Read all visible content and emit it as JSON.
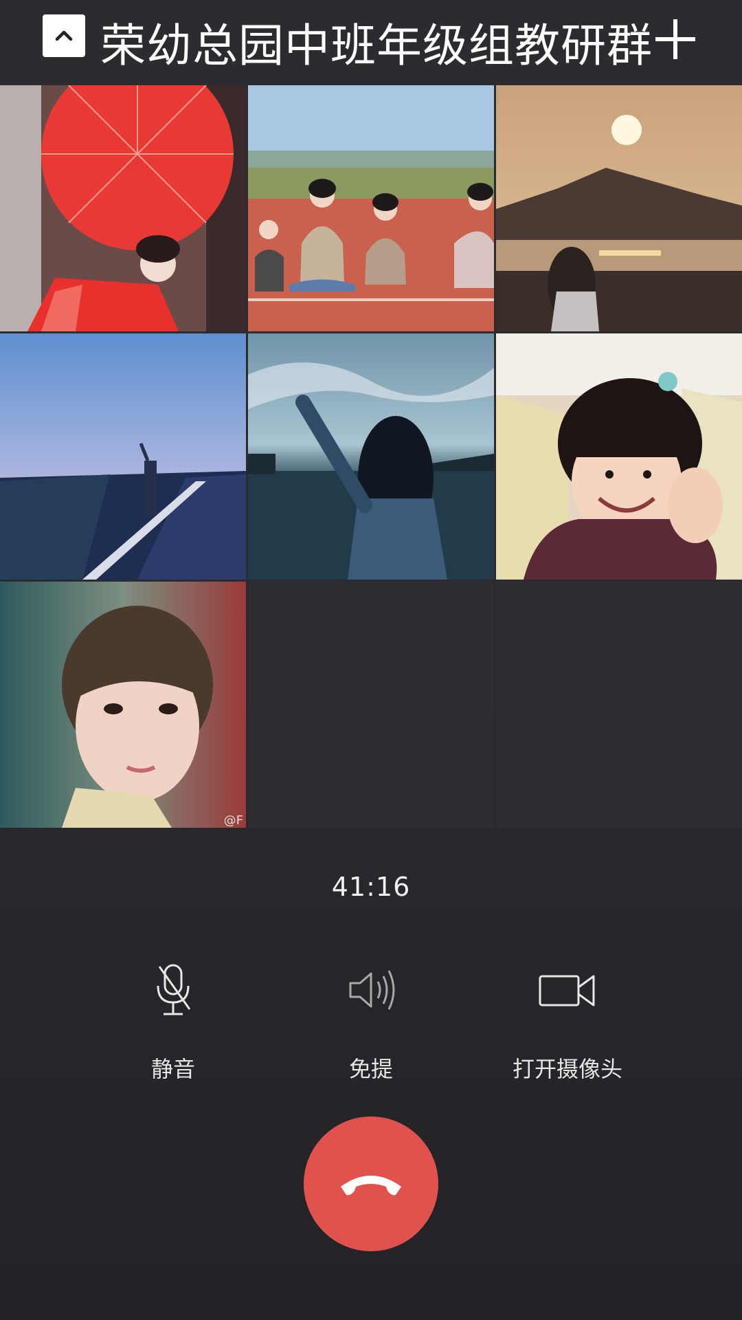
{
  "header": {
    "title": "荣幼总园中班年级组教研群",
    "collapse_icon": "chevron-up-icon",
    "add_icon": "plus-icon"
  },
  "participants": [
    {
      "tile": "red-umbrella-photo"
    },
    {
      "tile": "group-on-track-photo"
    },
    {
      "tile": "sunset-lake-photo"
    },
    {
      "tile": "road-dusk-photo"
    },
    {
      "tile": "waterfront-wave-photo"
    },
    {
      "tile": "smiling-child-photo"
    },
    {
      "tile": "short-hair-portrait-photo",
      "watermark": "@F"
    }
  ],
  "call": {
    "timer": "41:16"
  },
  "controls": {
    "mute_label": "静音",
    "speaker_label": "免提",
    "camera_label": "打开摄像头"
  },
  "colors": {
    "background": "#27272c",
    "header": "#2b2b30",
    "hangup": "#e0524d",
    "empty_tile": "#2d2d32"
  }
}
